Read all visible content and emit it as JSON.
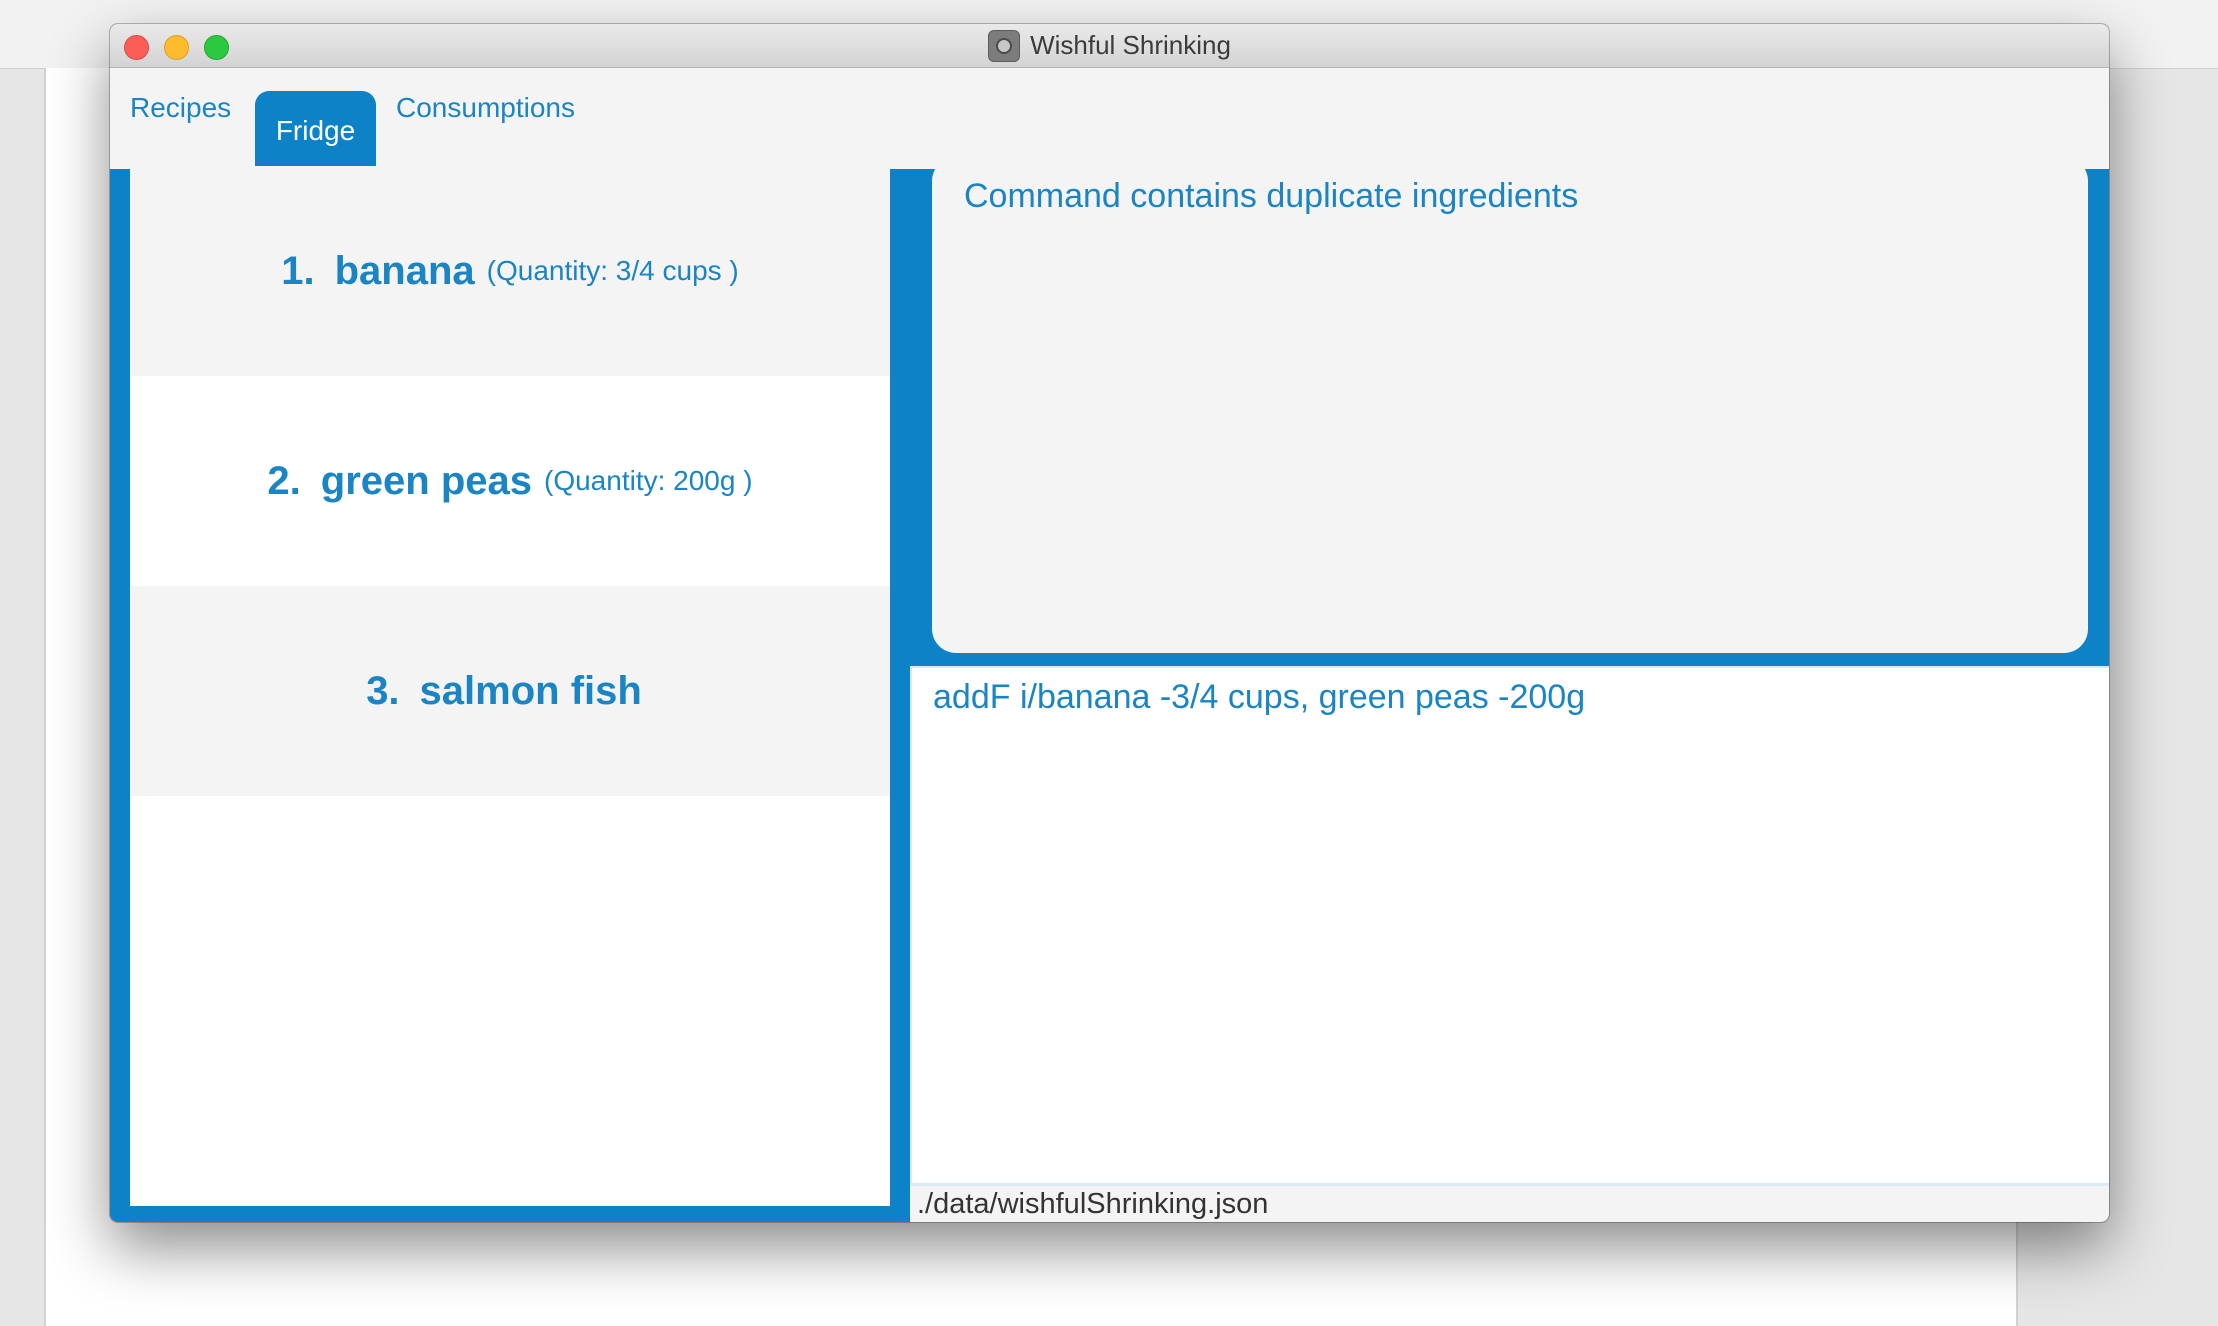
{
  "window": {
    "title": "Wishful Shrinking"
  },
  "tabs": [
    {
      "label": "Recipes",
      "selected": false
    },
    {
      "label": "Fridge",
      "selected": true
    },
    {
      "label": "Consumptions",
      "selected": false
    }
  ],
  "fridge_list": [
    {
      "index": "1.",
      "name": "banana",
      "quantity": "(Quantity: 3/4 cups )"
    },
    {
      "index": "2.",
      "name": "green peas",
      "quantity": "(Quantity: 200g )"
    },
    {
      "index": "3.",
      "name": "salmon fish",
      "quantity": ""
    }
  ],
  "result_display": {
    "message": "Command contains duplicate ingredients"
  },
  "command_box": {
    "value": "addF i/banana -3/4 cups, green peas -200g"
  },
  "status_bar": {
    "file_path": "./data/wishfulShrinking.json"
  },
  "colors": {
    "accent": "#0d82c6",
    "text_accent": "#1a84c4",
    "panel_bg": "#f4f4f4"
  },
  "icons": {
    "app_icon": "wishful-shrinking-app-icon"
  }
}
